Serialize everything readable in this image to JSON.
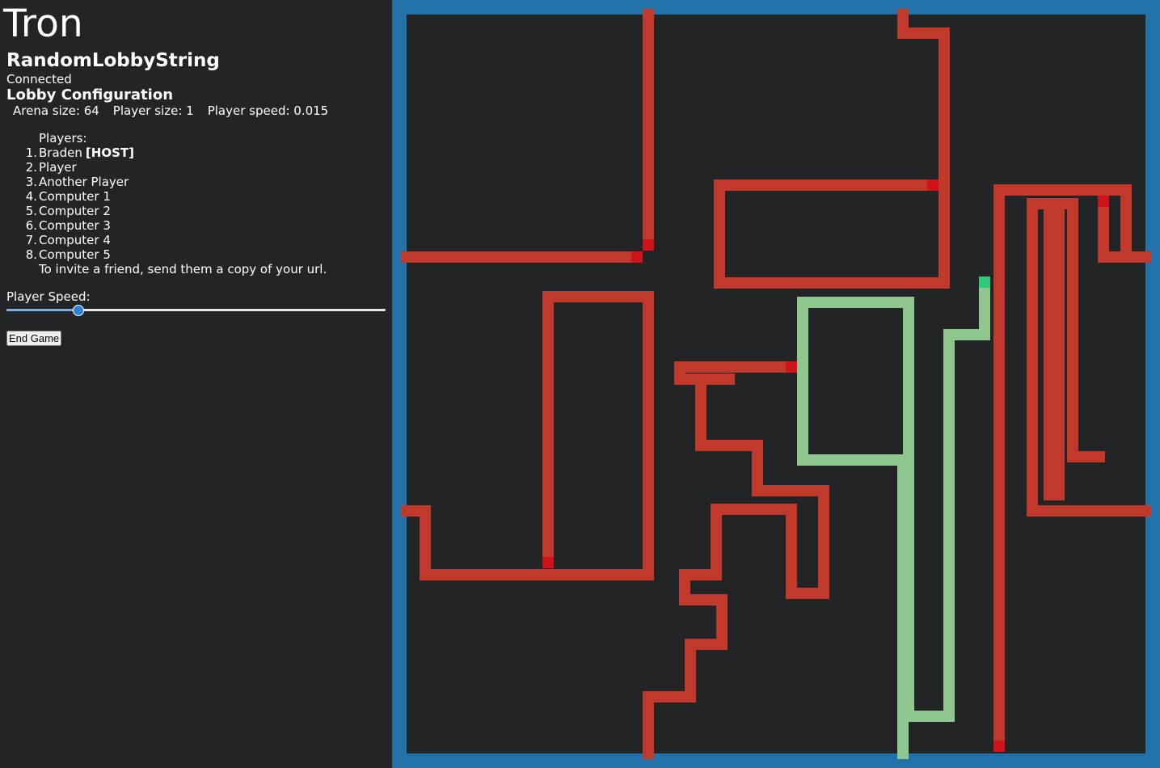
{
  "app": {
    "title": "Tron",
    "lobby_name": "RandomLobbyString",
    "status": "Connected"
  },
  "config": {
    "heading": "Lobby Configuration",
    "arena_size": "Arena size: 64",
    "player_size": "Player size: 1",
    "player_speed": "Player speed: 0.015"
  },
  "players": {
    "label": "Players:",
    "list": [
      {
        "num": "1.",
        "name": "Braden",
        "tag": "[HOST]"
      },
      {
        "num": "2.",
        "name": "Player",
        "tag": ""
      },
      {
        "num": "3.",
        "name": "Another Player",
        "tag": ""
      },
      {
        "num": "4.",
        "name": "Computer 1",
        "tag": ""
      },
      {
        "num": "5.",
        "name": "Computer 2",
        "tag": ""
      },
      {
        "num": "6.",
        "name": "Computer 3",
        "tag": ""
      },
      {
        "num": "7.",
        "name": "Computer 4",
        "tag": ""
      },
      {
        "num": "8.",
        "name": "Computer 5",
        "tag": ""
      }
    ],
    "invite_text": "To invite a friend, send them a copy of your url."
  },
  "speed_control": {
    "label": "Player Speed:",
    "value_fraction": 0.19
  },
  "end_game_label": "End Game",
  "colors": {
    "background": "#232425",
    "arena_border": "#2271a9",
    "arena_floor": "#232425",
    "enemy_trail": "#c0392b",
    "enemy_head": "#d0121b",
    "player_trail": "#8fc78f",
    "player_head": "#2ec87a"
  }
}
